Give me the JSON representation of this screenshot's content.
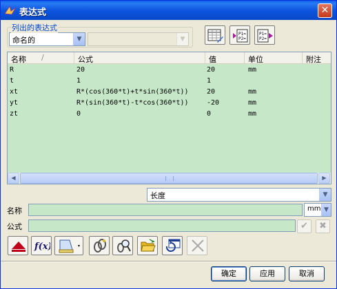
{
  "window": {
    "title": "表达式",
    "close_glyph": "✕"
  },
  "filter": {
    "legend": "列出的表达式",
    "selected": "命名的",
    "secondary_selected": ""
  },
  "list": {
    "columns": [
      {
        "label": "名称",
        "sort": "ascending"
      },
      {
        "label": "公式"
      },
      {
        "label": "值"
      },
      {
        "label": "单位"
      },
      {
        "label": "附注"
      }
    ],
    "rows": [
      {
        "name": "R",
        "formula": "20",
        "value": "20",
        "unit": "mm",
        "note": ""
      },
      {
        "name": "t",
        "formula": "1",
        "value": "1",
        "unit": "",
        "note": ""
      },
      {
        "name": "xt",
        "formula": "R*(cos(360*t)+t*sin(360*t))",
        "value": "20",
        "unit": "mm",
        "note": ""
      },
      {
        "name": "yt",
        "formula": "R*(sin(360*t)-t*cos(360*t))",
        "value": "-20",
        "unit": "mm",
        "note": ""
      },
      {
        "name": "zt",
        "formula": "0",
        "value": "0",
        "unit": "mm",
        "note": ""
      }
    ],
    "scroll_grip": "|||"
  },
  "dimension": {
    "selected": "长度"
  },
  "name_field": {
    "label": "名称",
    "value": "",
    "unit": "mm"
  },
  "formula_field": {
    "label": "公式",
    "value": ""
  },
  "buttons": {
    "ok": "确定",
    "apply": "应用",
    "cancel": "取消"
  },
  "colors": {
    "list_background": "#c6e8c8",
    "accent_blue": "#0046d5",
    "title_blue": "#0a5fe8",
    "delete_red": "#c0001a"
  }
}
